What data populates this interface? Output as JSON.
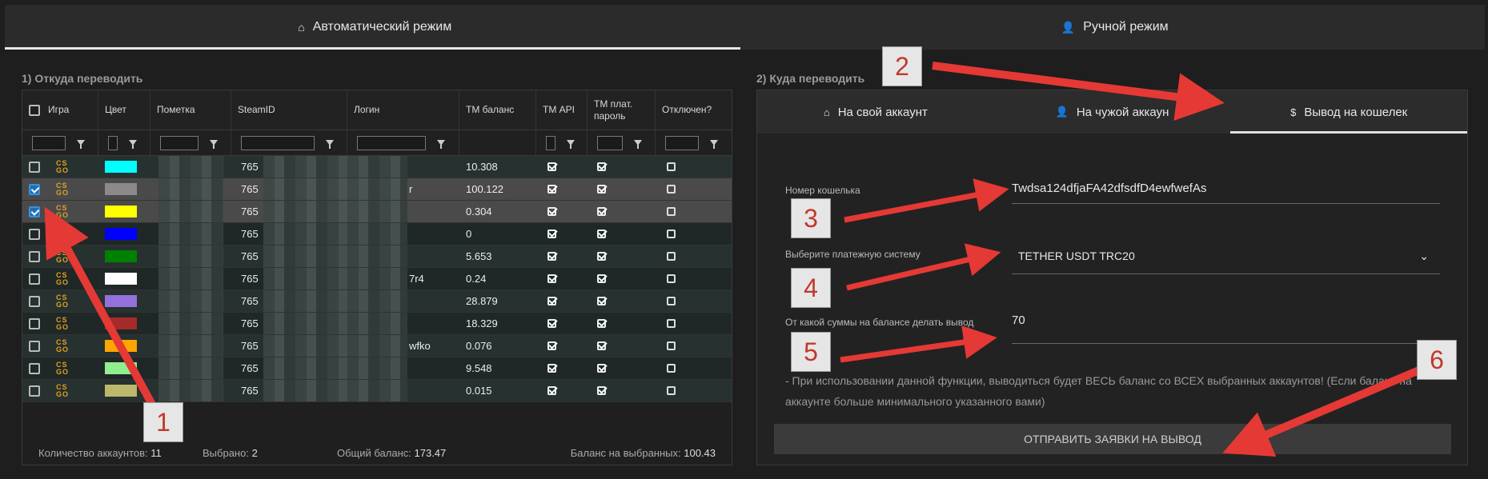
{
  "tabs": {
    "auto": "Автоматический режим",
    "manual": "Ручной режим"
  },
  "left": {
    "title": "1) Откуда переводить",
    "columns": [
      "Игра",
      "Цвет",
      "Пометка",
      "SteamID",
      "Логин",
      "ТМ баланс",
      "ТМ API",
      "ТМ плат. пароль",
      "Отключен?"
    ],
    "rows": [
      {
        "color": "#00ffff",
        "steam": "765",
        "login": "",
        "balance": "10.308",
        "selected": false
      },
      {
        "color": "#8a8a8a",
        "steam": "765",
        "login": "r",
        "balance": "100.122",
        "selected": true
      },
      {
        "color": "#ffff00",
        "steam": "765",
        "login": "",
        "balance": "0.304",
        "selected": true
      },
      {
        "color": "#0000ff",
        "steam": "765",
        "login": "",
        "balance": "0",
        "selected": false
      },
      {
        "color": "#008000",
        "steam": "765",
        "login": "",
        "balance": "5.653",
        "selected": false
      },
      {
        "color": "#ffffff",
        "steam": "765",
        "login": "7r4",
        "balance": "0.24",
        "selected": false
      },
      {
        "color": "#9370db",
        "steam": "765",
        "login": "",
        "balance": "28.879",
        "selected": false
      },
      {
        "color": "#a52a2a",
        "steam": "765",
        "login": "",
        "balance": "18.329",
        "selected": false
      },
      {
        "color": "#ffa500",
        "steam": "765",
        "login": "wfko",
        "balance": "0.076",
        "selected": false
      },
      {
        "color": "#90ee90",
        "steam": "765",
        "login": "",
        "balance": "9.548",
        "selected": false
      },
      {
        "color": "#bdb76b",
        "steam": "765",
        "login": "",
        "balance": "0.015",
        "selected": false
      }
    ],
    "game_label": "CS GO",
    "footer": {
      "count_label": "Количество аккаунтов:",
      "count": "11",
      "selected_label": "Выбрано:",
      "selected": "2",
      "total_label": "Общий баланс:",
      "total": "173.47",
      "sel_balance_label": "Баланс на выбранных:",
      "sel_balance": "100.43"
    }
  },
  "right": {
    "title": "2) Куда переводить",
    "subtabs": [
      "На свой аккаунт",
      "На чужой аккаун",
      "Вывод на кошелек"
    ],
    "wallet_label": "Номер кошелька",
    "wallet_value": "Twdsa124dfjaFA42dfsdfD4ewfwefAs",
    "system_label": "Выберите платежную систему",
    "system_value": "TETHER USDT TRC20",
    "min_label": "От какой суммы на балансе делать вывод",
    "min_value": "70",
    "note": "- При использовании данной функции, выводиться будет ВЕСЬ баланс со ВСЕХ выбранных аккаунтов! (Если баланс на аккаунте больше минимального указанного вами)",
    "submit": "ОТПРАВИТЬ ЗАЯВКИ НА ВЫВОД"
  },
  "badges": [
    "1",
    "2",
    "3",
    "4",
    "5",
    "6"
  ],
  "accent": "#e53935"
}
